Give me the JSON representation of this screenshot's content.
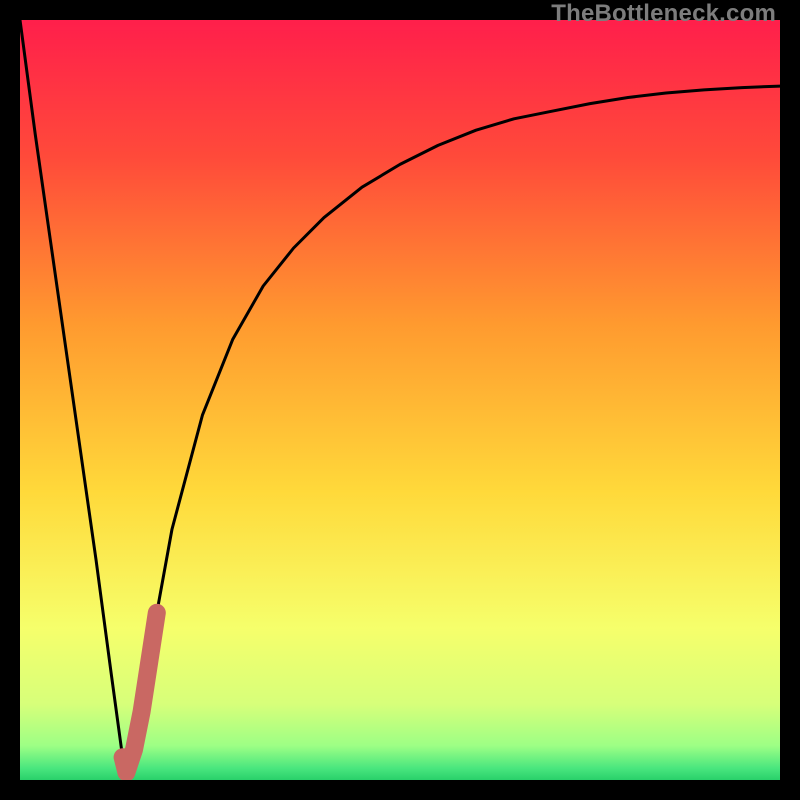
{
  "watermark": "TheBottleneck.com",
  "colors": {
    "bg": "#000000",
    "gradient_top": "#ff1f4b",
    "gradient_mid_top": "#ff6d2f",
    "gradient_mid": "#ffd23a",
    "gradient_mid_bot": "#f6ff6b",
    "gradient_bot": "#6cff8f",
    "gradient_bot2": "#29e06e",
    "curve": "#000000",
    "highlight": "#c96863"
  },
  "chart_data": {
    "type": "line",
    "title": "",
    "xlabel": "",
    "ylabel": "",
    "xlim": [
      0,
      100
    ],
    "ylim": [
      0,
      100
    ],
    "grid": false,
    "series": [
      {
        "name": "bottleneck-curve",
        "x": [
          0,
          2,
          4,
          6,
          8,
          10,
          12,
          13.5,
          14,
          16,
          18,
          20,
          24,
          28,
          32,
          36,
          40,
          45,
          50,
          55,
          60,
          65,
          70,
          75,
          80,
          85,
          90,
          95,
          100
        ],
        "y": [
          100,
          85,
          71,
          57,
          43,
          29,
          14,
          3,
          1,
          9,
          22,
          33,
          48,
          58,
          65,
          70,
          74,
          78,
          81,
          83.5,
          85.5,
          87,
          88,
          89,
          89.8,
          90.4,
          90.8,
          91.1,
          91.3
        ]
      },
      {
        "name": "highlight-segment",
        "x": [
          13.5,
          14,
          15,
          16,
          17,
          18
        ],
        "y": [
          3,
          1,
          4,
          9,
          15.5,
          22
        ]
      }
    ]
  }
}
